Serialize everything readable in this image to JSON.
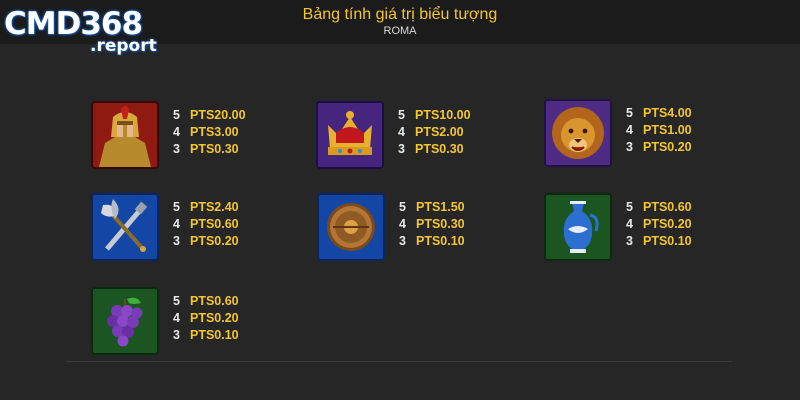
{
  "header": {
    "title": "Bảng tính giá trị biểu tượng",
    "subtitle": "ROMA"
  },
  "logo": {
    "main": "CMD368",
    "sub": ".report"
  },
  "colors": {
    "background": "#262626",
    "header": "#1b1b1b",
    "value": "#f3c62e",
    "count": "#e8e8e8"
  },
  "symbols": [
    {
      "icon": "warrior-icon",
      "pays": [
        {
          "count": "5",
          "value": "PTS20.00"
        },
        {
          "count": "4",
          "value": "PTS3.00"
        },
        {
          "count": "3",
          "value": "PTS0.30"
        }
      ]
    },
    {
      "icon": "crown-icon",
      "pays": [
        {
          "count": "5",
          "value": "PTS10.00"
        },
        {
          "count": "4",
          "value": "PTS2.00"
        },
        {
          "count": "3",
          "value": "PTS0.30"
        }
      ]
    },
    {
      "icon": "lion-icon",
      "pays": [
        {
          "count": "5",
          "value": "PTS4.00"
        },
        {
          "count": "4",
          "value": "PTS1.00"
        },
        {
          "count": "3",
          "value": "PTS0.20"
        }
      ]
    },
    {
      "icon": "axe-sword-icon",
      "pays": [
        {
          "count": "5",
          "value": "PTS2.40"
        },
        {
          "count": "4",
          "value": "PTS0.60"
        },
        {
          "count": "3",
          "value": "PTS0.20"
        }
      ]
    },
    {
      "icon": "shield-icon",
      "pays": [
        {
          "count": "5",
          "value": "PTS1.50"
        },
        {
          "count": "4",
          "value": "PTS0.30"
        },
        {
          "count": "3",
          "value": "PTS0.10"
        }
      ]
    },
    {
      "icon": "vase-icon",
      "pays": [
        {
          "count": "5",
          "value": "PTS0.60"
        },
        {
          "count": "4",
          "value": "PTS0.20"
        },
        {
          "count": "3",
          "value": "PTS0.10"
        }
      ]
    },
    {
      "icon": "grapes-icon",
      "pays": [
        {
          "count": "5",
          "value": "PTS0.60"
        },
        {
          "count": "4",
          "value": "PTS0.20"
        },
        {
          "count": "3",
          "value": "PTS0.10"
        }
      ]
    }
  ]
}
